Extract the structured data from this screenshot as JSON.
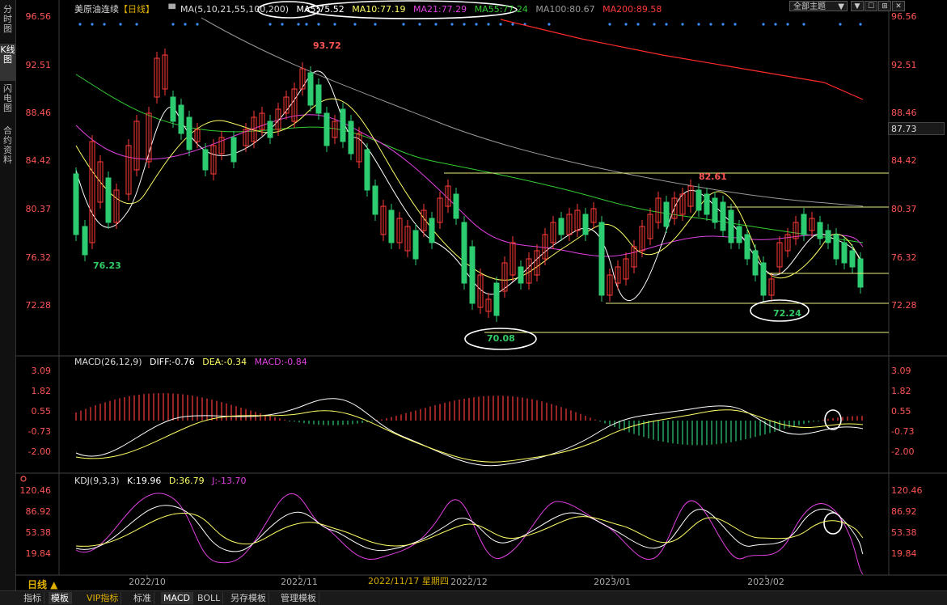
{
  "sidebar": {
    "tabs": [
      {
        "label": "分时图",
        "active": false
      },
      {
        "label": "K线图",
        "active": true
      },
      {
        "label": "闪电图",
        "active": false
      },
      {
        "label": "合约资料",
        "active": false
      }
    ]
  },
  "header": {
    "instrument": "美原油连续",
    "period_tag": "【日线】",
    "ma_params": "MA(5,10,21,55,100,200)",
    "ma5": "MA5:75.52",
    "ma10": "MA10:77.19",
    "ma21": "MA21:77.29",
    "ma55": "MA55:77.24",
    "ma100": "MA100:80.67",
    "ma200": "MA200:89.58",
    "theme_select": "全部主题",
    "buttons": [
      "▼",
      "☐",
      "⊞",
      "✕"
    ]
  },
  "price_axis": {
    "left_labels": [
      "96.56",
      "92.51",
      "88.46",
      "84.42",
      "80.37",
      "76.32",
      "72.28"
    ],
    "right_labels": [
      "96.56",
      "92.51",
      "88.46",
      "84.42",
      "80.37",
      "76.32",
      "72.28"
    ],
    "current_price": "87.73"
  },
  "annotations": {
    "high_1": "93.72",
    "high_2": "82.61",
    "low_1": "76.23",
    "low_2": "70.08",
    "low_3": "72.24"
  },
  "macd": {
    "title": "MACD(26,12,9)",
    "diff": "DIFF:-0.76",
    "dea": "DEA:-0.34",
    "macd": "MACD:-0.84",
    "labels": [
      "3.09",
      "1.82",
      "0.55",
      "-0.73",
      "-2.00"
    ]
  },
  "kdj": {
    "title": "KDJ(9,3,3)",
    "k": "K:19.96",
    "d": "D:36.79",
    "j": "J:-13.70",
    "labels": [
      "120.46",
      "86.92",
      "53.38",
      "19.84"
    ]
  },
  "time_axis": {
    "labels": [
      "2022/10",
      "2022/11",
      "2022/12",
      "2023/01",
      "2023/02"
    ],
    "cursor_date": "2022/11/17 星期四"
  },
  "period_label": "日线 ▲",
  "bottom_tabs": [
    {
      "label": "指标",
      "selected": false
    },
    {
      "label": "模板",
      "selected": true
    },
    {
      "label": "VIP指标",
      "selected": false
    },
    {
      "label": "标准",
      "selected": false
    },
    {
      "label": "MACD",
      "selected": true
    },
    {
      "label": "BOLL",
      "selected": false
    },
    {
      "label": "另存模板",
      "selected": false
    },
    {
      "label": "管理模板",
      "selected": false
    }
  ],
  "colors": {
    "up": "#ff3b3b",
    "down": "#2ecc71",
    "ma5": "#ffffff",
    "ma10": "#ffff66",
    "ma21": "#e040e0",
    "ma55": "#33cc33",
    "ma100": "#9a9a9a",
    "ma200": "#ff2a2a"
  }
}
